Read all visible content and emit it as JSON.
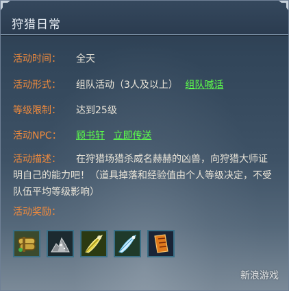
{
  "panel": {
    "title": "狩猎日常"
  },
  "rows": {
    "time": {
      "label": "活动时间：",
      "value": "全天"
    },
    "form": {
      "label": "活动形式：",
      "value": "组队活动（3人及以上）",
      "link": "组队喊话"
    },
    "level": {
      "label": "等级限制：",
      "value": "达到25级"
    },
    "npc": {
      "label": "活动NPC：",
      "npc_link": "顾书轩",
      "teleport_link": "立即传送"
    },
    "desc": {
      "label": "活动描述：",
      "text": "在狩猎场猎杀威名赫赫的凶兽，向狩猎大师证明自己的能力吧！（道具掉落和经验值由个人等级决定，不受队伍平均等级影响）"
    },
    "rewards": {
      "label": "活动奖励："
    }
  },
  "rewards": [
    {
      "icon": "scroll-bundle-icon"
    },
    {
      "icon": "ore-pile-icon"
    },
    {
      "icon": "golden-feather-icon"
    },
    {
      "icon": "white-feather-icon"
    },
    {
      "icon": "orange-talisman-icon"
    }
  ],
  "watermark": "新浪游戏",
  "colors": {
    "label": "#f08a3c",
    "value": "#e9e4d8",
    "link": "#5cff4a",
    "title": "#e8eef5"
  }
}
